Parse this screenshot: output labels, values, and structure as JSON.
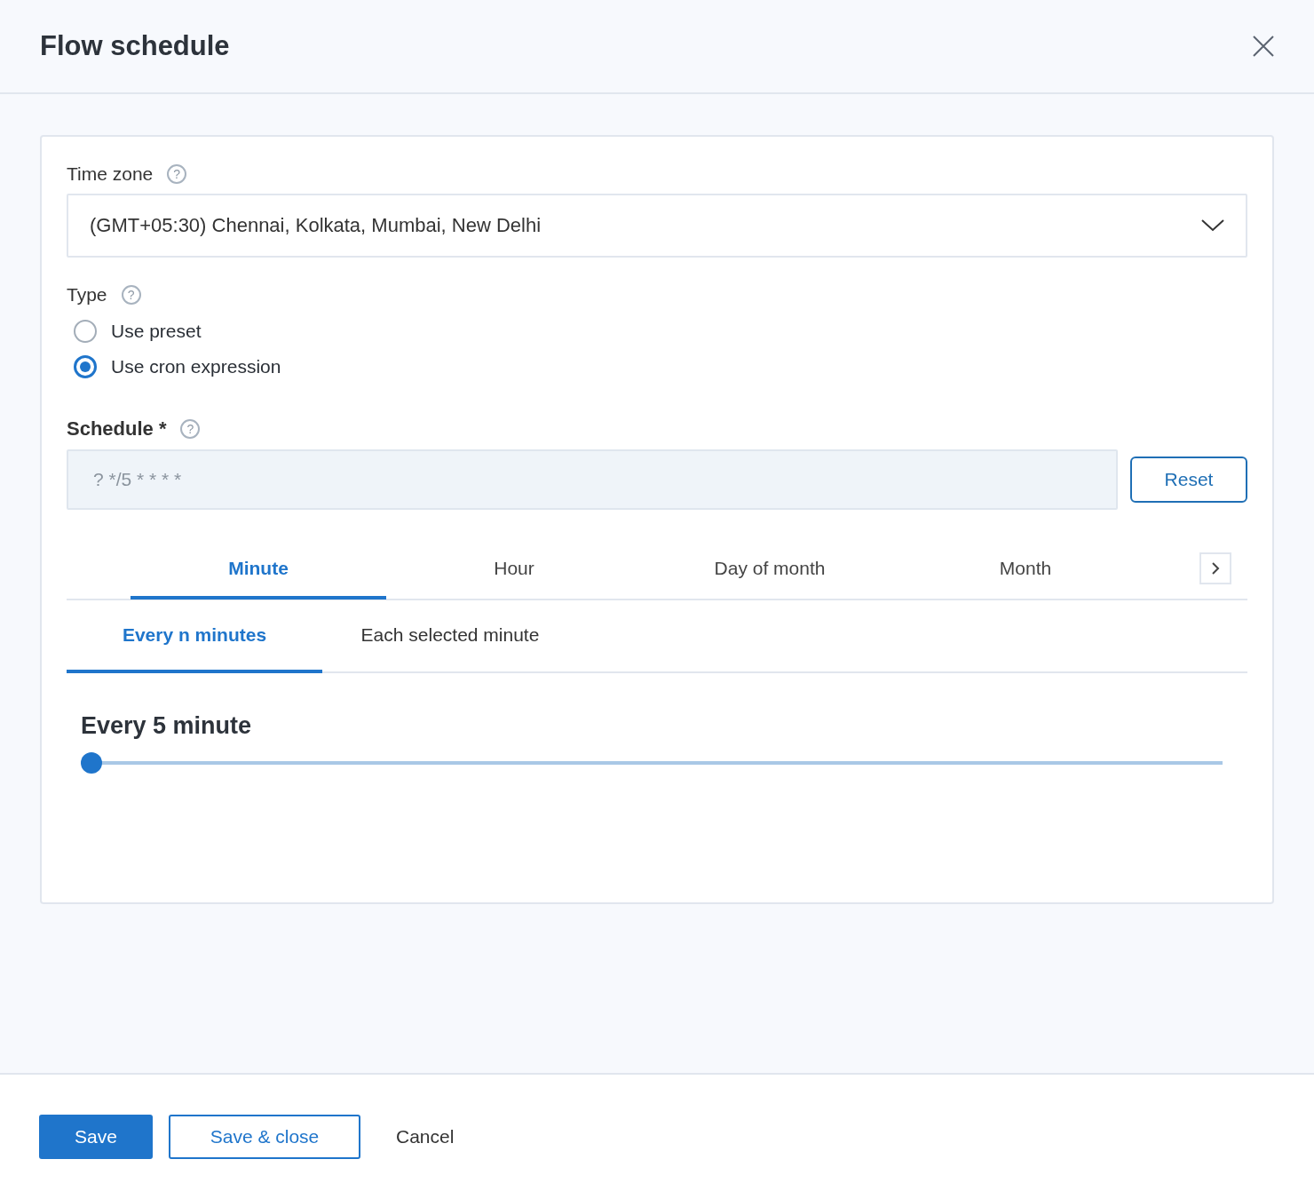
{
  "dialog": {
    "title": "Flow schedule"
  },
  "time_zone": {
    "label": "Time zone",
    "help": "?",
    "value": "(GMT+05:30) Chennai, Kolkata, Mumbai, New Delhi"
  },
  "type": {
    "label": "Type",
    "help": "?",
    "options": [
      {
        "label": "Use preset",
        "selected": false
      },
      {
        "label": "Use cron expression",
        "selected": true
      }
    ]
  },
  "schedule": {
    "label": "Schedule",
    "help": "?",
    "required_mark": "*",
    "value": "? */5 * * * *",
    "reset": "Reset"
  },
  "tabs": [
    {
      "label": "Minute",
      "selected": true
    },
    {
      "label": "Hour",
      "selected": false
    },
    {
      "label": "Day of month",
      "selected": false
    },
    {
      "label": "Month",
      "selected": false
    }
  ],
  "subtabs": [
    {
      "label": "Every n minutes",
      "selected": true
    },
    {
      "label": "Each selected minute",
      "selected": false
    }
  ],
  "interval": {
    "heading": "Every 5 minute",
    "level": 0
  },
  "footer": {
    "buttons": [
      {
        "label": "Save",
        "kind": "primary"
      },
      {
        "label": "Save & close",
        "kind": "outline"
      },
      {
        "label": "Cancel",
        "kind": "text"
      }
    ]
  }
}
